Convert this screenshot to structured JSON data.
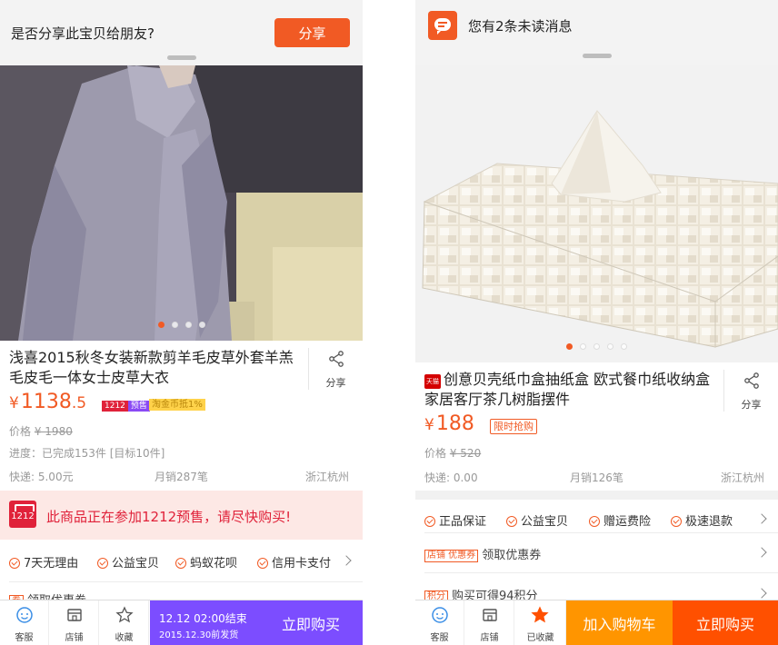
{
  "left": {
    "share_prompt": "是否分享此宝贝给朋友?",
    "share_button": "分享",
    "title": "浅喜2015秋冬女装新款剪羊毛皮草外套羊羔毛皮毛一体女士皮草大衣",
    "share_side_label": "分享",
    "price_symbol": "¥",
    "price_int": "1138",
    "price_dec": ".5",
    "tag_1212_a": "1212",
    "tag_1212_b": "预售",
    "tag_coin": "淘金币抵1%",
    "original_price_label": "价格",
    "original_price": "¥ 1980",
    "progress": "进度：已完成153件 [目标10件]",
    "shipping": "快递: 5.00元",
    "monthly_sales": "月销287笔",
    "location": "浙江杭州",
    "banner_logo": "1212",
    "banner_text": "此商品正在参加1212预售，请尽快购买!",
    "services": [
      "7天无理由",
      "公益宝贝",
      "蚂蚁花呗",
      "信用卡支付"
    ],
    "coupon_tag": "券",
    "coupon_text": "领取优惠券",
    "tabs": [
      "客服",
      "店铺",
      "收藏"
    ],
    "deadline_line1": "12.12 02:00结束",
    "deadline_line2": "2015.12.30前发货",
    "buy_button": "立即购买"
  },
  "right": {
    "message_text": "您有2条未读消息",
    "tmall_badge": "天猫",
    "title": "创意贝壳纸巾盒抽纸盒 欧式餐巾纸收纳盒家居客厅茶几树脂摆件",
    "share_side_label": "分享",
    "price_symbol": "¥",
    "price_int": "188",
    "tag_limit": "限时抢购",
    "original_price_label": "价格",
    "original_price": "¥ 520",
    "shipping": "快递: 0.00",
    "monthly_sales": "月销126笔",
    "location": "浙江杭州",
    "services": [
      "正品保证",
      "公益宝贝",
      "赠运费险",
      "极速退款"
    ],
    "coupon_tag": "店铺  优惠券",
    "coupon_text": "领取优惠券",
    "points_tag": "积分",
    "points_text": "购买可得94积分",
    "tabs": [
      "客服",
      "店铺",
      "已收藏"
    ],
    "add_cart_button": "加入购物车",
    "buy_button": "立即购买"
  },
  "colors": {
    "accent": "#f15a24",
    "purple": "#7c4dff",
    "cart_orange": "#ff9500",
    "buy_orange": "#ff5000",
    "banner_bg": "#fde8e5",
    "banner_red": "#e0223a"
  },
  "icons": [
    "share-icon",
    "message-icon",
    "customer-service-icon",
    "store-icon",
    "favorite-star-icon",
    "checkmark-circle-icon",
    "chevron-right-icon",
    "tmall-icon"
  ]
}
